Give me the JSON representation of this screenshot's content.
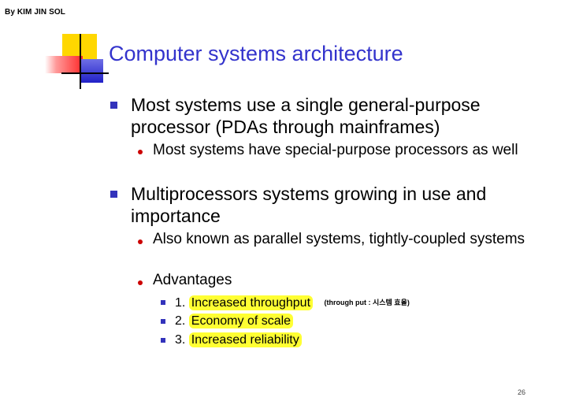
{
  "author": "By KIM JIN SOL",
  "title": "Computer systems architecture",
  "bullets": {
    "b1": "Most systems use a single general-purpose processor (PDAs through mainframes)",
    "b1_1": "Most systems have special-purpose processors as well",
    "b2": "Multiprocessors systems growing in use and importance",
    "b2_1": "Also known as parallel systems, tightly-coupled systems",
    "b2_2": "Advantages",
    "adv": [
      {
        "num": "1.",
        "text": "Increased throughput"
      },
      {
        "num": "2.",
        "text": "Economy of scale"
      },
      {
        "num": "3.",
        "text": "Increased reliability"
      }
    ],
    "note": "(through put : 시스템 효율)"
  },
  "page_number": "26",
  "colors": {
    "title": "#3333cc",
    "highlight": "#ffff33",
    "level1_bullet": "#3333bb",
    "level2_bullet": "#cc0000"
  }
}
